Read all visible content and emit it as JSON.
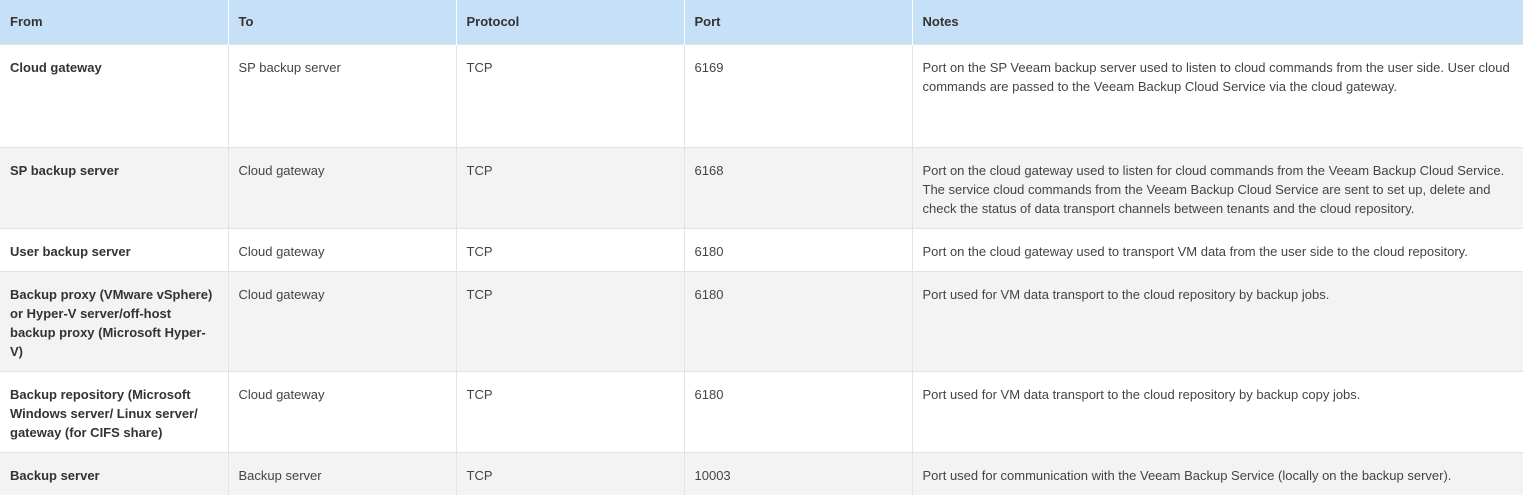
{
  "columns": {
    "from": "From",
    "to": "To",
    "protocol": "Protocol",
    "port": "Port",
    "notes": "Notes"
  },
  "rows": [
    {
      "from": "Cloud gateway",
      "to": "SP backup server",
      "protocol": "TCP",
      "port": "6169",
      "notes": "Port on the SP Veeam backup server used to listen to cloud commands from the user side. User cloud commands are passed to the Veeam Backup Cloud Service via the cloud gateway."
    },
    {
      "from": "SP backup server",
      "to": "Cloud gateway",
      "protocol": "TCP",
      "port": "6168",
      "notes": "Port on the cloud gateway used to listen for cloud commands from the Veeam Backup Cloud Service. The service cloud commands from the Veeam Backup Cloud Service are sent to set up, delete and check the status of data transport channels between tenants and the cloud repository."
    },
    {
      "from": "User backup server",
      "to": "Cloud gateway",
      "protocol": "TCP",
      "port": "6180",
      "notes": "Port on the cloud gateway used to transport VM data from the user side to the cloud repository."
    },
    {
      "from": "Backup proxy (VMware vSphere) or Hyper-V server/off-host backup proxy (Microsoft Hyper-V)",
      "to": "Cloud gateway",
      "protocol": "TCP",
      "port": "6180",
      "notes": "Port used for VM data transport to the cloud repository by backup jobs."
    },
    {
      "from": "Backup repository (Microsoft Windows server/ Linux server/ gateway (for CIFS share)",
      "to": "Cloud gateway",
      "protocol": "TCP",
      "port": "6180",
      "notes": "Port used for VM data transport to the cloud repository by backup copy jobs."
    },
    {
      "from": "Backup server",
      "to": "Backup server",
      "protocol": "TCP",
      "port": "10003",
      "notes": "Port used for communication with the Veeam Backup Service (locally on the backup server)."
    }
  ],
  "colors": {
    "header_bg": "#c6e0f7",
    "row_alt_bg": "#f3f3f3",
    "border": "#e3e3e3"
  }
}
